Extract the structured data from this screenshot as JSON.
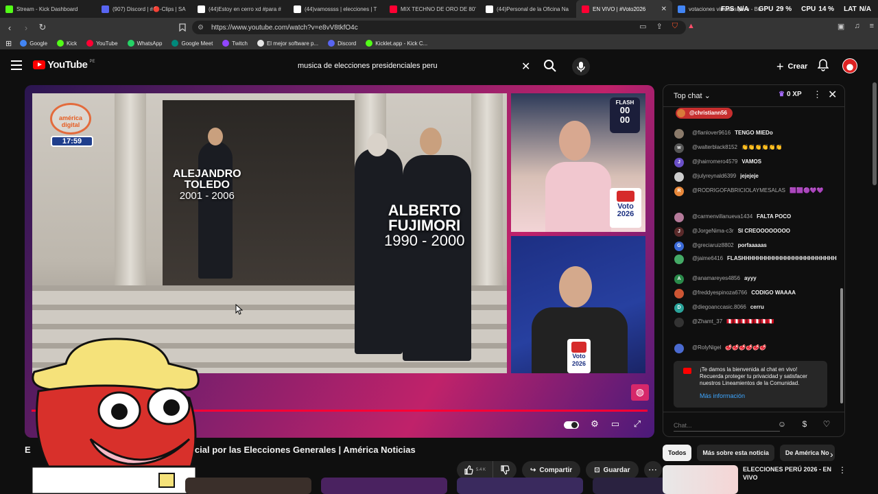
{
  "browser": {
    "tabs": [
      {
        "title": "Stream - Kick Dashboard",
        "icon": "kick-icon",
        "color": "#53fc18"
      },
      {
        "title": "(907) Discord | #🔴-Clips | SA",
        "icon": "discord-icon",
        "color": "#5865f2"
      },
      {
        "title": "(44)Estoy en cerro xd #para #",
        "icon": "tiktok-icon",
        "color": "#ffffff"
      },
      {
        "title": "(44)vamossss | elecciones | T",
        "icon": "tiktok-icon",
        "color": "#ffffff"
      },
      {
        "title": "MIX TECHNO DE ORO DE 80'",
        "icon": "youtube-icon",
        "color": "#ff0033"
      },
      {
        "title": "(44)Personal de la Oficina Na",
        "icon": "tiktok-icon",
        "color": "#ffffff"
      },
      {
        "title": "EN VIVO | #Voto2026",
        "icon": "youtube-icon",
        "color": "#ff0033",
        "active": true
      },
      {
        "title": "votaciones virtuales peru - Bu",
        "icon": "google-icon",
        "color": "#4285f4"
      }
    ],
    "perf": {
      "fps_label": "FPS",
      "fps_value": "N/A",
      "gpu_label": "GPU",
      "gpu_value": "29 %",
      "cpu_label": "CPU",
      "cpu_value": "14 %",
      "lat_label": "LAT",
      "lat_value": "N/A"
    },
    "url": "https://www.youtube.com/watch?v=e8vV8tkfO4c",
    "bookmarks": [
      {
        "label": "Google",
        "color": "#4285f4"
      },
      {
        "label": "Kick",
        "color": "#53fc18"
      },
      {
        "label": "YouTube",
        "color": "#ff0033"
      },
      {
        "label": "WhatsApp",
        "color": "#25d366"
      },
      {
        "label": "Google Meet",
        "color": "#00897b"
      },
      {
        "label": "Twitch",
        "color": "#9146ff"
      },
      {
        "label": "El mejor software p...",
        "color": "#e6e6e6"
      },
      {
        "label": "Discord",
        "color": "#5865f2"
      },
      {
        "label": "Kicklet.app - Kick C...",
        "color": "#53fc18"
      }
    ]
  },
  "youtube": {
    "logo_text": "YouTube",
    "country": "PE",
    "search_value": "musica de elecciones presidenciales peru",
    "create_label": "Crear"
  },
  "video": {
    "toledo_name_1": "ALEJANDRO",
    "toledo_name_2": "TOLEDO",
    "toledo_years": "2001 - 2006",
    "fuji_name_1": "ALBERTO",
    "fuji_name_2": "FUJIMORI",
    "fuji_years": "1990 - 2000",
    "channel_logo_1": "américa",
    "channel_logo_2": "digital",
    "clock": "17:59",
    "flash_label": "FLASH",
    "flash_top": "00",
    "flash_bottom": "00",
    "voto_label": "Voto",
    "voto_year": "2026",
    "progress": 1.0,
    "title_start": "E",
    "title_end": "cial por las Elecciones Generales | América Noticias"
  },
  "actions": {
    "like_count": "5.4 K",
    "share_label": "Compartir",
    "save_label": "Guardar"
  },
  "chat": {
    "header": "Top chat",
    "xp": "0 XP",
    "pinned_user": "@christiann56",
    "messages": [
      {
        "author": "@flanlover9616",
        "text": "TENGO MIEDo",
        "initial": "",
        "color": "#8a7a6a"
      },
      {
        "author": "@walterblack8152",
        "text": "👏👏👏👏👏👏",
        "initial": "w",
        "color": "#555555"
      },
      {
        "author": "@jhairromero4579",
        "text": "VAMOS",
        "initial": "J",
        "color": "#6a4fc8"
      },
      {
        "author": "@julyreynald6399",
        "text": "jejejeje",
        "initial": "",
        "color": "#cccccc"
      },
      {
        "author": "@RODRIGOFABRICIOLAYMESALAS",
        "text": "🟪🟪🟣💜💜",
        "initial": "R",
        "color": "#e8883a"
      },
      {
        "author": "@carmenvillanueva1434",
        "text": "FALTA POCO",
        "initial": "",
        "color": "#b57a9a"
      },
      {
        "author": "@JorgeNima-c3r",
        "text": "SI CREOOOOOOOO",
        "initial": "J",
        "color": "#5a2a2a"
      },
      {
        "author": "@greciaruiz8802",
        "text": "porfaaaaas",
        "initial": "G",
        "color": "#3a6ad8"
      },
      {
        "author": "@jaime6416",
        "text": "FLASHHHHHHHHHHHHHHHHHHHHHHHH",
        "initial": "",
        "color": "#44aa66"
      },
      {
        "author": "@anamareyes4856",
        "text": "ayyy",
        "initial": "A",
        "color": "#2a8a4a"
      },
      {
        "author": "@freddyespinoza6766",
        "text": "CODIGO WAAAA",
        "initial": "",
        "color": "#cc5533"
      },
      {
        "author": "@diegoanccasic.8066",
        "text": "cerru",
        "initial": "D",
        "color": "#2aa39a"
      },
      {
        "author": "@Zhamt_37",
        "text": "🇵🇪🇵🇪🇵🇪🇵🇪🇵🇪🇵🇪🇵🇪",
        "initial": "",
        "color": "#333333"
      },
      {
        "author": "@RolyNigel",
        "text": "🥩🥩🥩🥩🥩🥩",
        "initial": "",
        "color": "#4a6ad0"
      }
    ],
    "welcome_text": "¡Te damos la bienvenida al chat en vivo! Recuerda proteger tu privacidad y satisfacer nuestros Lineamientos de la Comunidad.",
    "welcome_link": "Más información",
    "input_placeholder": "Chat..."
  },
  "chips": [
    "Todos",
    "Más sobre esta noticia",
    "De América No"
  ],
  "recommendation": {
    "title": "ELECCIONES PERÚ 2026 - EN VIVO"
  }
}
